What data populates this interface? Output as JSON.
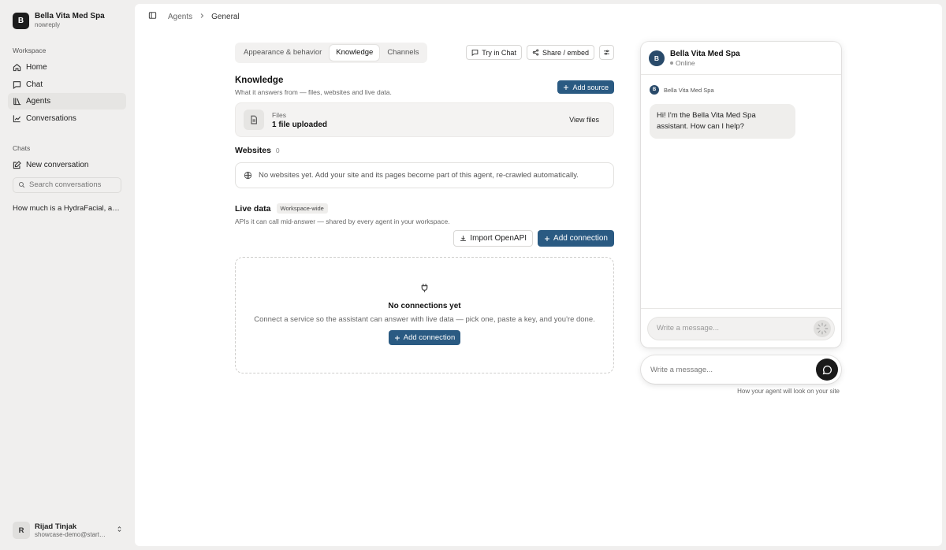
{
  "workspace": {
    "initial": "B",
    "name": "Bella Vita Med Spa",
    "subtitle": "nowreply"
  },
  "sidebar": {
    "workspace_label": "Workspace",
    "nav": [
      {
        "label": "Home",
        "icon": "home-icon"
      },
      {
        "label": "Chat",
        "icon": "chat-bubble-icon"
      },
      {
        "label": "Agents",
        "icon": "books-icon",
        "active": true
      },
      {
        "label": "Conversations",
        "icon": "line-chart-icon"
      }
    ],
    "chats_label": "Chats",
    "new_conversation": "New conversation",
    "search_placeholder": "Search conversations",
    "history": [
      "How much is a HydraFacial, and..."
    ]
  },
  "user": {
    "initial": "R",
    "name": "Rijad Tinjak",
    "email": "showcase-demo@starter.com"
  },
  "breadcrumb": {
    "parent": "Agents",
    "current": "General"
  },
  "tabs": [
    {
      "label": "Appearance & behavior"
    },
    {
      "label": "Knowledge",
      "active": true
    },
    {
      "label": "Channels"
    }
  ],
  "toolbar": {
    "try_chat": "Try in Chat",
    "share": "Share / embed"
  },
  "knowledge": {
    "title": "Knowledge",
    "description": "What it answers from — files, websites and live data.",
    "add_source": "Add source",
    "files_label": "Files",
    "files_count": "1 file uploaded",
    "view_files": "View files"
  },
  "websites": {
    "title": "Websites",
    "count": "0",
    "empty": "No websites yet. Add your site and its pages become part of this agent, re-crawled automatically."
  },
  "live_data": {
    "title": "Live data",
    "badge": "Workspace-wide",
    "description": "APIs it can call mid-answer — shared by every agent in your workspace.",
    "import": "Import OpenAPI",
    "add_connection": "Add connection",
    "empty_title": "No connections yet",
    "empty_desc": "Connect a service so the assistant can answer with live data — pick one, paste a key, and you're done.",
    "empty_button": "Add connection"
  },
  "preview": {
    "initial": "B",
    "name": "Bella Vita Med Spa",
    "status": "Online",
    "sender": "Bella Vita Med Spa",
    "greeting": "Hi! I'm the Bella Vita Med Spa assistant. How can I help?",
    "input_placeholder": "Write a message...",
    "launcher_placeholder": "Write a message...",
    "note": "How your agent will look on your site"
  },
  "colors": {
    "primary": "#2a5a82",
    "avatar": "#294a6a",
    "sidebar_bg": "#f0efee"
  }
}
